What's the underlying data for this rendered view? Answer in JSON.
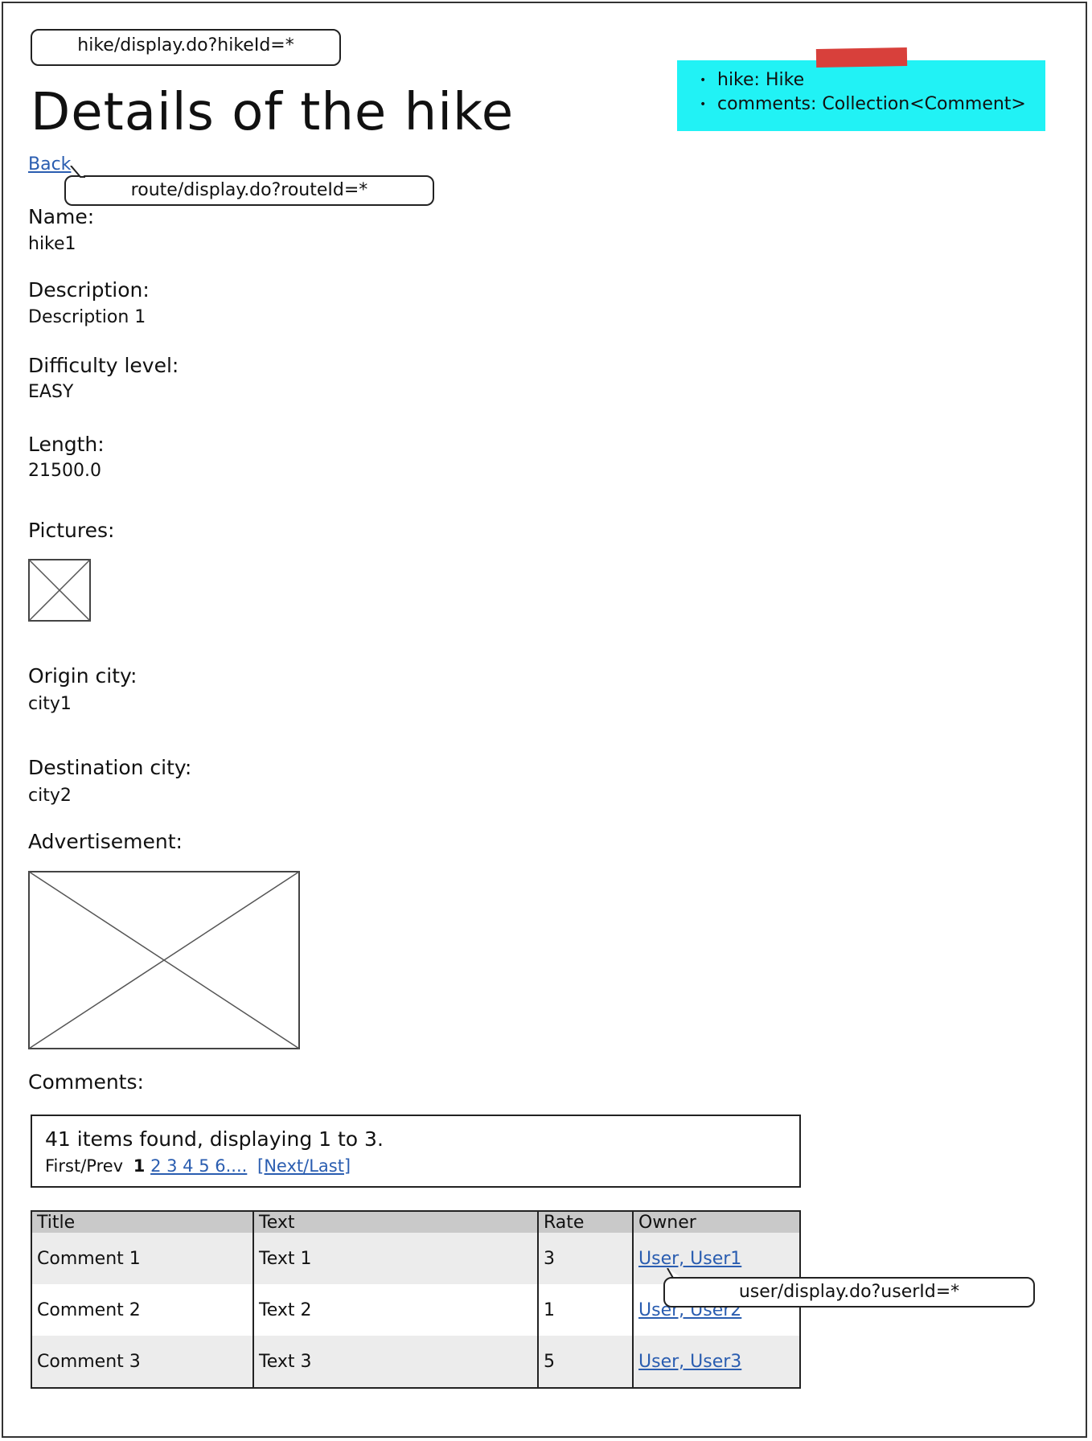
{
  "callouts": {
    "hike_url": "hike/display.do?hikeId=*",
    "route_url": "route/display.do?routeId=*",
    "user_url": "user/display.do?userId=*"
  },
  "page_title": "Details of the hike",
  "note": {
    "items": [
      "hike: Hike",
      "comments: Collection<Comment>"
    ]
  },
  "back_link": "Back",
  "fields": {
    "name": {
      "label": "Name:",
      "value": "hike1"
    },
    "description": {
      "label": "Description:",
      "value": "Description 1"
    },
    "difficulty": {
      "label": "Difficulty level:",
      "value": "EASY"
    },
    "length": {
      "label": "Length:",
      "value": "21500.0"
    },
    "pictures": {
      "label": "Pictures:"
    },
    "origin": {
      "label": "Origin city:",
      "value": "city1"
    },
    "destination": {
      "label": "Destination city:",
      "value": "city2"
    },
    "advertisement": {
      "label": "Advertisement:"
    },
    "comments": {
      "label": "Comments:"
    }
  },
  "pager": {
    "count_text": "41 items found, displaying 1 to 3.",
    "first_prev": "First/Prev",
    "current": "1",
    "pages": "2 3 4 5 6....",
    "next_last": "[Next/Last]"
  },
  "table": {
    "headers": [
      "Title",
      "Text",
      "Rate",
      "Owner"
    ],
    "rows": [
      [
        "Comment 1",
        "Text 1",
        "3",
        "User, User1"
      ],
      [
        "Comment 2",
        "Text 2",
        "1",
        "User, User2"
      ],
      [
        "Comment 3",
        "Text 3",
        "5",
        "User, User3"
      ]
    ]
  },
  "colors": {
    "note_bg": "#21f2f5",
    "tape": "#d8403b",
    "link": "#2a5db0",
    "header_bg": "#c9c9c9"
  }
}
